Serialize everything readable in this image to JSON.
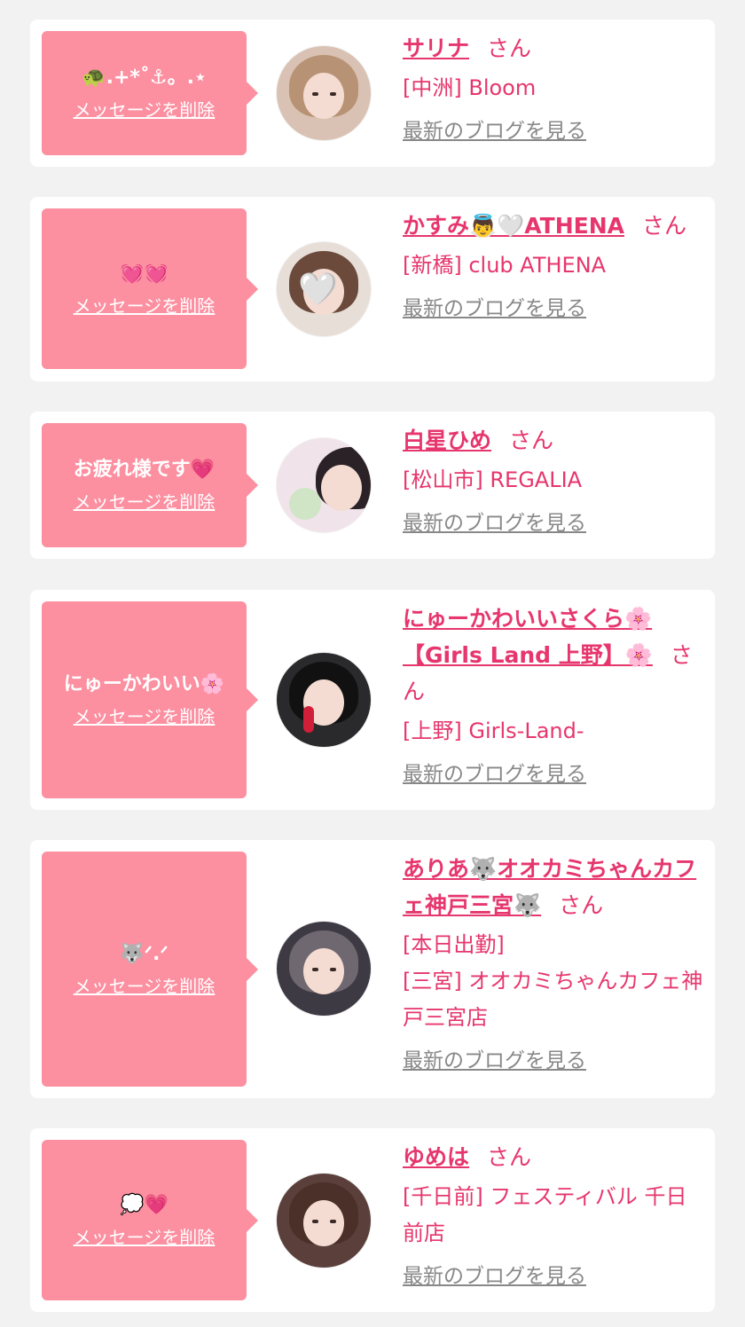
{
  "delete_label": "メッセージを削除",
  "blog_label": "最新のブログを見る",
  "honorific": "さん",
  "colors": {
    "background": "#f2f2f2",
    "bubble": "#fc8fa0",
    "accent": "#e6366d",
    "link_gray": "#888888"
  },
  "items": [
    {
      "message": "🐢.+*˚⚓︎。.⋆",
      "name": "サリナ",
      "shop": "[中洲] Bloom",
      "status": ""
    },
    {
      "message": "💓💓",
      "name": "かすみ👼🤍ATHENA",
      "shop": "[新橋] club ATHENA",
      "status": ""
    },
    {
      "message": "お疲れ様です💗",
      "name": "白星ひめ",
      "shop": "[松山市] REGALIA",
      "status": ""
    },
    {
      "message": "にゅーかわいい🌸",
      "name": "にゅーかわいいさくら🌸【Girls Land 上野】🌸",
      "shop": "[上野] Girls-Land-",
      "status": ""
    },
    {
      "message": "🐺ᐟ.ᐟ",
      "name": "ありあ🐺オオカミちゃんカフェ神戸三宮🐺",
      "shop": "[三宮] オオカミちゃんカフェ神戸三宮店",
      "status": "[本日出勤]"
    },
    {
      "message": "💭💗",
      "name": "ゆめは",
      "shop": "[千日前] フェスティバル 千日前店",
      "status": ""
    }
  ]
}
